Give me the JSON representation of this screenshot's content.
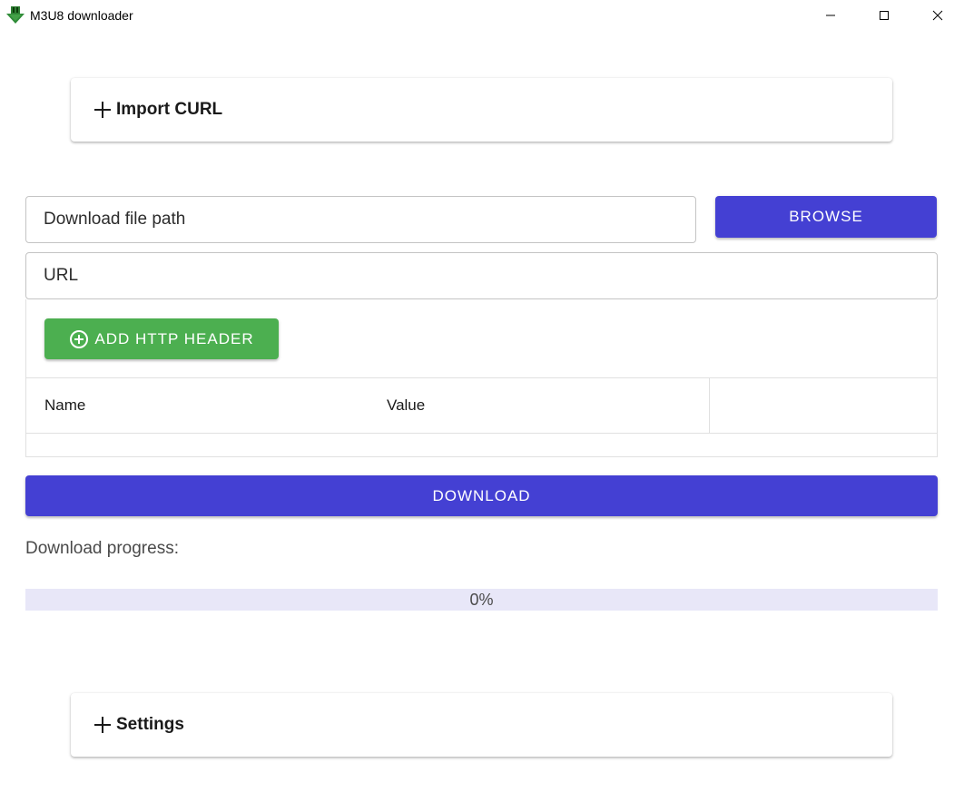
{
  "window": {
    "title": "M3U8 downloader",
    "app_icon": "download-arrow-icon",
    "controls": [
      "minimize-icon",
      "maximize-icon",
      "close-icon"
    ]
  },
  "import_curl": {
    "label": "Import CURL",
    "icon": "plus-icon"
  },
  "form": {
    "download_path_placeholder": "Download file path",
    "browse_label": "BROWSE",
    "url_placeholder": "URL"
  },
  "headers": {
    "add_label": "ADD HTTP HEADER",
    "add_icon": "circle-plus-icon",
    "columns": [
      "Name",
      "Value"
    ],
    "rows": []
  },
  "download": {
    "label": "DOWNLOAD"
  },
  "progress": {
    "label": "Download progress:",
    "text": "0%",
    "value": 0
  },
  "settings": {
    "label": "Settings",
    "icon": "plus-icon"
  },
  "colors": {
    "primary": "#4440d3",
    "success": "#4caf50",
    "progress_track": "#e8e7f8"
  }
}
